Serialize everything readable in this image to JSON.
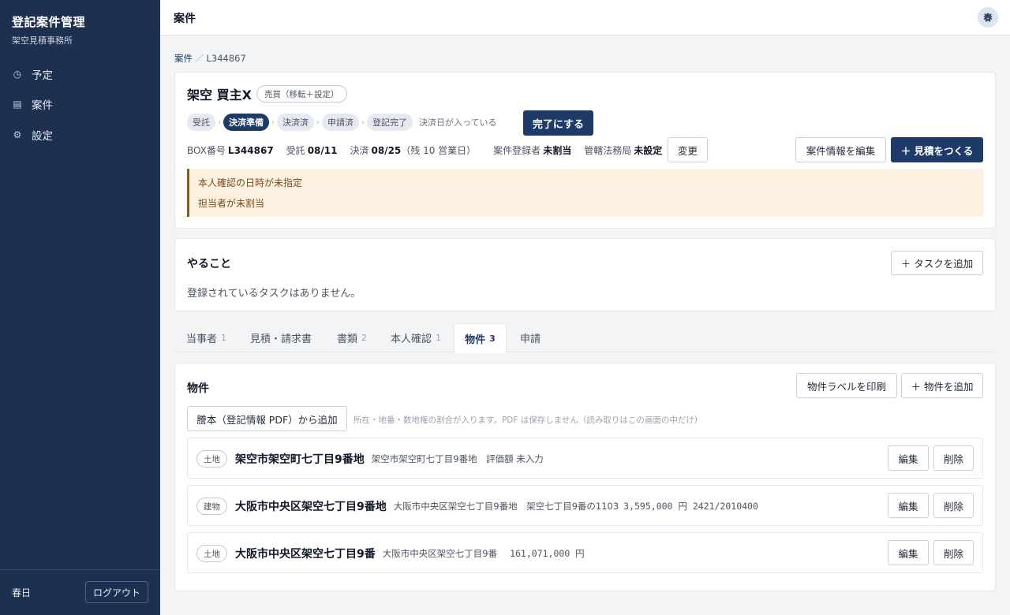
{
  "sidebar": {
    "app_title": "登記案件管理",
    "office": "架空見積事務所",
    "nav": [
      {
        "icon": "clock-icon",
        "glyph": "◷",
        "label": "予定"
      },
      {
        "icon": "list-icon",
        "glyph": "▤",
        "label": "案件"
      },
      {
        "icon": "gear-icon",
        "glyph": "⚙",
        "label": "設定"
      }
    ],
    "user_name": "春日",
    "logout_label": "ログアウト"
  },
  "topbar": {
    "title": "案件",
    "avatar": "春"
  },
  "breadcrumb": {
    "parent": "案件",
    "separator": "／",
    "current": "L344867"
  },
  "case": {
    "name": "架空 買主X",
    "type": "売買（移転＋設定）",
    "steps": [
      "受託",
      "決済準備",
      "決済済",
      "申請済",
      "登記完了"
    ],
    "active_step": 1,
    "step_sep": "›",
    "step_note": "決済日が入っている",
    "complete_label": "完了にする",
    "box_label": "BOX番号",
    "box_value": "L344867",
    "received_label": "受託",
    "received_value": "08/11",
    "settle_label": "決済",
    "settle_value": "08/25",
    "settle_remaining": "（残 10 営業日）",
    "registrant_label": "案件登録者",
    "registrant_value": "未割当",
    "bureau_label": "管轄法務局",
    "bureau_value": "未設定",
    "change_label": "変更",
    "edit_label": "案件情報を編集",
    "estimate_label": "＋ 見積をつくる",
    "alerts": [
      "本人確認の日時が未指定",
      "担当者が未割当"
    ]
  },
  "todo": {
    "title": "やること",
    "add_label": "＋ タスクを追加",
    "empty": "登録されているタスクはありません。"
  },
  "tabs": [
    {
      "label": "当事者",
      "count": "1"
    },
    {
      "label": "見積・請求書",
      "count": ""
    },
    {
      "label": "書類",
      "count": "2"
    },
    {
      "label": "本人確認",
      "count": "1"
    },
    {
      "label": "物件",
      "count": "3"
    },
    {
      "label": "申請",
      "count": ""
    }
  ],
  "active_tab": 4,
  "properties": {
    "title": "物件",
    "print_label": "物件ラベルを印刷",
    "add_label": "＋ 物件を追加",
    "pdf_label": "謄本（登記情報 PDF）から追加",
    "hint": "所在・地番・数地権の割合が入ります。PDF は保存しません（読み取りはこの画面の中だけ）",
    "edit_label": "編集",
    "delete_label": "削除",
    "items": [
      {
        "kind": "土地",
        "location": "架空市架空町七丁目9番地",
        "detail": "架空市架空町七丁目9番地　評価額 未入力",
        "value": ""
      },
      {
        "kind": "建物",
        "location": "大阪市中央区架空七丁目9番地",
        "detail": "大阪市中央区架空七丁目9番地　架空七丁目9番の1103",
        "value": "3,595,000 円 2421/2010400"
      },
      {
        "kind": "土地",
        "location": "大阪市中央区架空七丁目9番",
        "detail": "大阪市中央区架空七丁目9番",
        "value": "161,071,000 円"
      }
    ]
  }
}
